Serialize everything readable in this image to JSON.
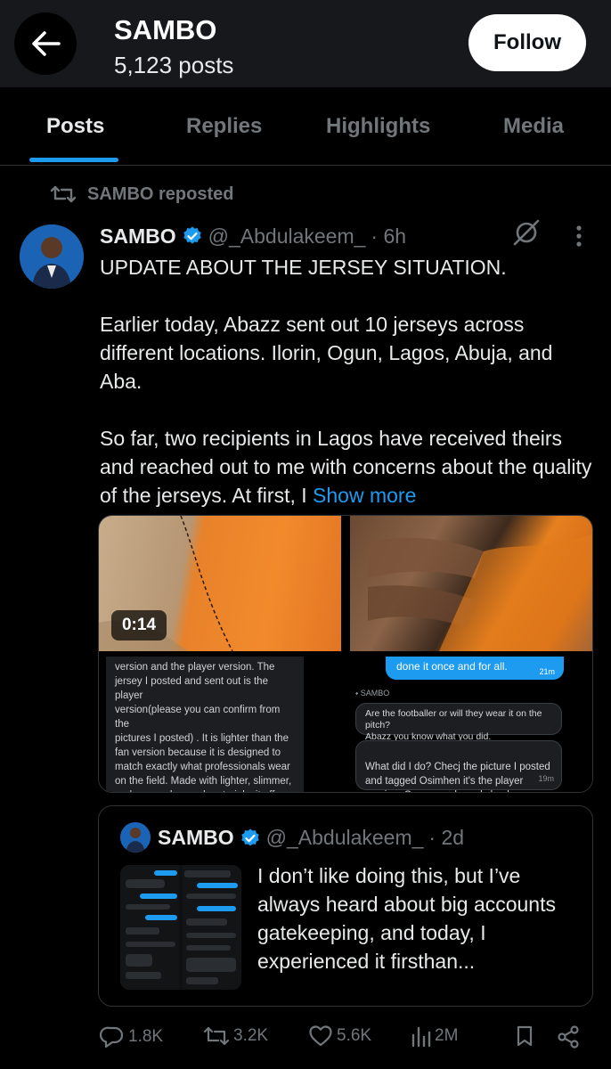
{
  "header": {
    "title": "SAMBO",
    "subtitle": "5,123 posts",
    "follow_label": "Follow"
  },
  "tabs": [
    {
      "label": "Posts",
      "active": true
    },
    {
      "label": "Replies",
      "active": false
    },
    {
      "label": "Highlights",
      "active": false
    },
    {
      "label": "Media",
      "active": false
    }
  ],
  "repost": {
    "label": "SAMBO reposted"
  },
  "post": {
    "author": "SAMBO",
    "handle": "@_Abdulakeem_",
    "time": "· 6h",
    "paragraphs": [
      "UPDATE ABOUT THE JERSEY SITUATION.",
      "Earlier today, Abazz sent out 10 jerseys across different locations. Ilorin, Ogun, Lagos, Abuja, and Aba.",
      "So far, two recipients in Lagos have received theirs and reached out to me with concerns about the quality of the jerseys. At first, I"
    ],
    "show_more": "Show more",
    "video_duration": "0:14",
    "screenshot_left_text": "version and the player version. The\njersey I posted and sent out is the player\nversion(please you can confirm from the\npictures I posted) . It is lighter than the\nfan version because it is designed to\nmatch exactly what professionals wear\non the field. Made with lighter, slimmer,\nand more advanced materials, it offers\nbetter performance and a sharper, more\nfitted look because of this it is less",
    "screenshot_right": {
      "blue_bubble": "done it once and for all.",
      "blue_time": "21m",
      "sender": "SAMBO",
      "grey_bubble_1": "Are the footballer or will they wear it on the pitch?\nAbazz you know what you did.",
      "grey_bubble_2": "What did I do? Checj the picture I posted\nand tagged Osimhen it's the player\nversion. Open google and check",
      "grey_time": "19m"
    }
  },
  "quote": {
    "author": "SAMBO",
    "handle": "@_Abdulakeem_",
    "time": "· 2d",
    "text": "I don’t like doing this, but I’ve always heard about big accounts gatekeeping, and today, I experienced it firsthan..."
  },
  "actions": {
    "replies": "1.8K",
    "reposts": "3.2K",
    "likes": "5.6K",
    "views": "2M"
  },
  "colors": {
    "accent": "#1d9bf0",
    "verified": "#1d9bf0",
    "muted": "#71767b",
    "background": "#000000"
  }
}
